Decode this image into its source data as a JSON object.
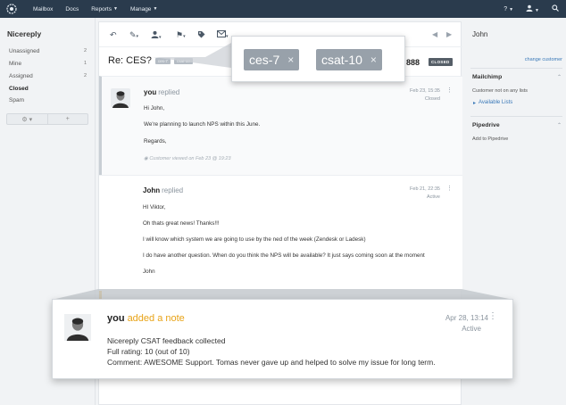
{
  "topnav": {
    "items": [
      {
        "label": "Mailbox"
      },
      {
        "label": "Docs"
      },
      {
        "label": "Reports"
      },
      {
        "label": "Manage"
      }
    ],
    "help_label": "?"
  },
  "sidebar": {
    "mailbox_name": "Nicereply",
    "folders": [
      {
        "label": "Unassigned",
        "count": "2"
      },
      {
        "label": "Mine",
        "count": "1"
      },
      {
        "label": "Assigned",
        "count": "2"
      },
      {
        "label": "Closed",
        "count": ""
      },
      {
        "label": "Spam",
        "count": ""
      }
    ],
    "settings_label": "⚙ ▾",
    "add_label": "+"
  },
  "conversation": {
    "subject": "Re: CES?",
    "mini_tags": [
      "ces-7",
      "csat-10"
    ],
    "number": "888",
    "status_badge": "CLOSED",
    "threads": [
      {
        "author": "you",
        "verb": "replied",
        "date": "Feb 23, 15:35",
        "status": "Closed",
        "lines": [
          "Hi John,",
          "We're planning to launch NPS within this June.",
          "Regards,"
        ],
        "viewed": "Customer viewed on Feb 23 @ 19:23"
      },
      {
        "author": "John",
        "verb": "replied",
        "date": "Feb 21, 22:35",
        "status": "Active",
        "lines": [
          "HI Viktor,",
          "Oh thats great news! Thanks!!!",
          "I will know which system we are going to use by the ned of the week (Zendesk or Ladesk)",
          "I do have another question. When do you think the NPS will be available? It just says coming soon at the moment",
          "John"
        ]
      }
    ]
  },
  "tags_callout": {
    "tags": [
      {
        "label": "ces-7",
        "remove": "×"
      },
      {
        "label": "csat-10",
        "remove": "×"
      }
    ]
  },
  "note": {
    "author": "you",
    "verb": "added a note",
    "date": "Apr 28, 13:14",
    "status": "Active",
    "menu": "⋮",
    "lines": [
      "Nicereply CSAT feedback collected",
      "Full rating: 10 (out of 10)",
      "Comment: AWESOME Support. Tomas never gave up and helped to solve my issue for long term."
    ]
  },
  "customer": {
    "name": "John",
    "change_link": "change customer",
    "mailchimp": {
      "title": "Mailchimp",
      "status": "Customer not on any lists",
      "lists_link": "Available Lists"
    },
    "pipedrive": {
      "title": "Pipedrive",
      "add_link": "Add to Pipedrive"
    }
  },
  "colors": {
    "nav_bg": "#2a3b4d",
    "note_accent": "#e8a317",
    "link": "#3a79b8",
    "tag_bg": "#98a1aa"
  },
  "icons": [
    "logo-icon",
    "help-icon",
    "user-icon",
    "search-icon",
    "reply-icon",
    "edit-icon",
    "assign-icon",
    "flag-icon",
    "tag-icon",
    "mail-icon",
    "prev-icon",
    "next-icon",
    "gear-icon",
    "plus-icon",
    "eye-icon",
    "kebab-icon"
  ]
}
